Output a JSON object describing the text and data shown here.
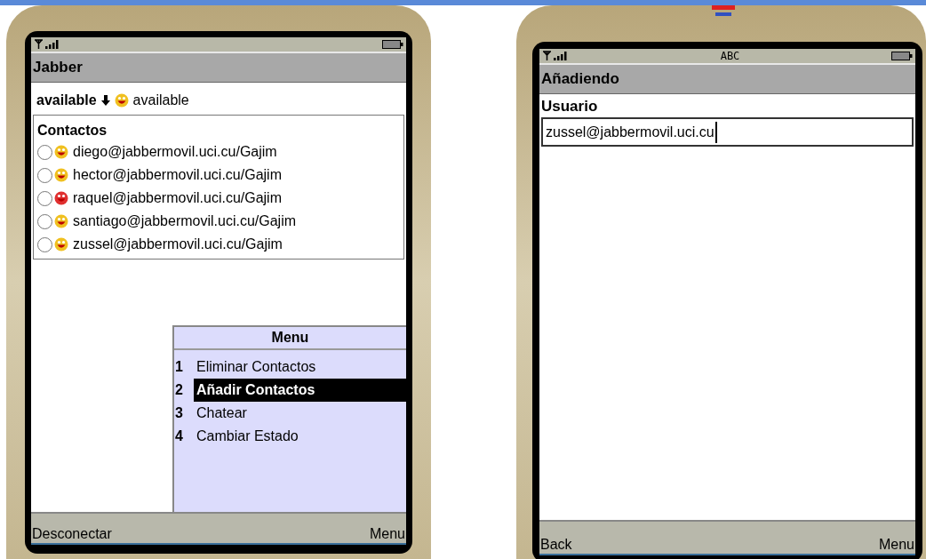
{
  "phones": [
    {
      "kind": "contacts",
      "title": "Jabber",
      "presence": {
        "label": "available",
        "value": "available",
        "color": "#f0c020"
      },
      "contacts": {
        "heading": "Contactos",
        "items": [
          {
            "address": "diego@jabbermovil.uci.cu/Gajim",
            "checked": false,
            "color": "#f0c020"
          },
          {
            "address": "hector@jabbermovil.uci.cu/Gajim",
            "checked": false,
            "color": "#f0c020"
          },
          {
            "address": "raquel@jabbermovil.uci.cu/Gajim",
            "checked": false,
            "color": "#e03030"
          },
          {
            "address": "santiago@jabbermovil.uci.cu/Gajim",
            "checked": false,
            "color": "#f0c020"
          },
          {
            "address": "zussel@jabbermovil.uci.cu/Gajim",
            "checked": false,
            "color": "#f0c020"
          }
        ]
      },
      "menu": {
        "title": "Menu",
        "items": [
          {
            "number": "1",
            "label": "Eliminar Contactos",
            "selected": false
          },
          {
            "number": "2",
            "label": "Añadir Contactos",
            "selected": true
          },
          {
            "number": "3",
            "label": "Chatear",
            "selected": false
          },
          {
            "number": "4",
            "label": "Cambiar Estado",
            "selected": false
          }
        ]
      },
      "softkeys": {
        "left": "Desconectar",
        "right": "Menu"
      }
    },
    {
      "kind": "form",
      "status_bar": {
        "input_mode": "ABC"
      },
      "title": "Añadiendo",
      "field": {
        "label": "Usuario",
        "value": "zussel@jabbermovil.uci.cu"
      },
      "softkeys": {
        "left": "Back",
        "right": "Menu"
      }
    }
  ]
}
